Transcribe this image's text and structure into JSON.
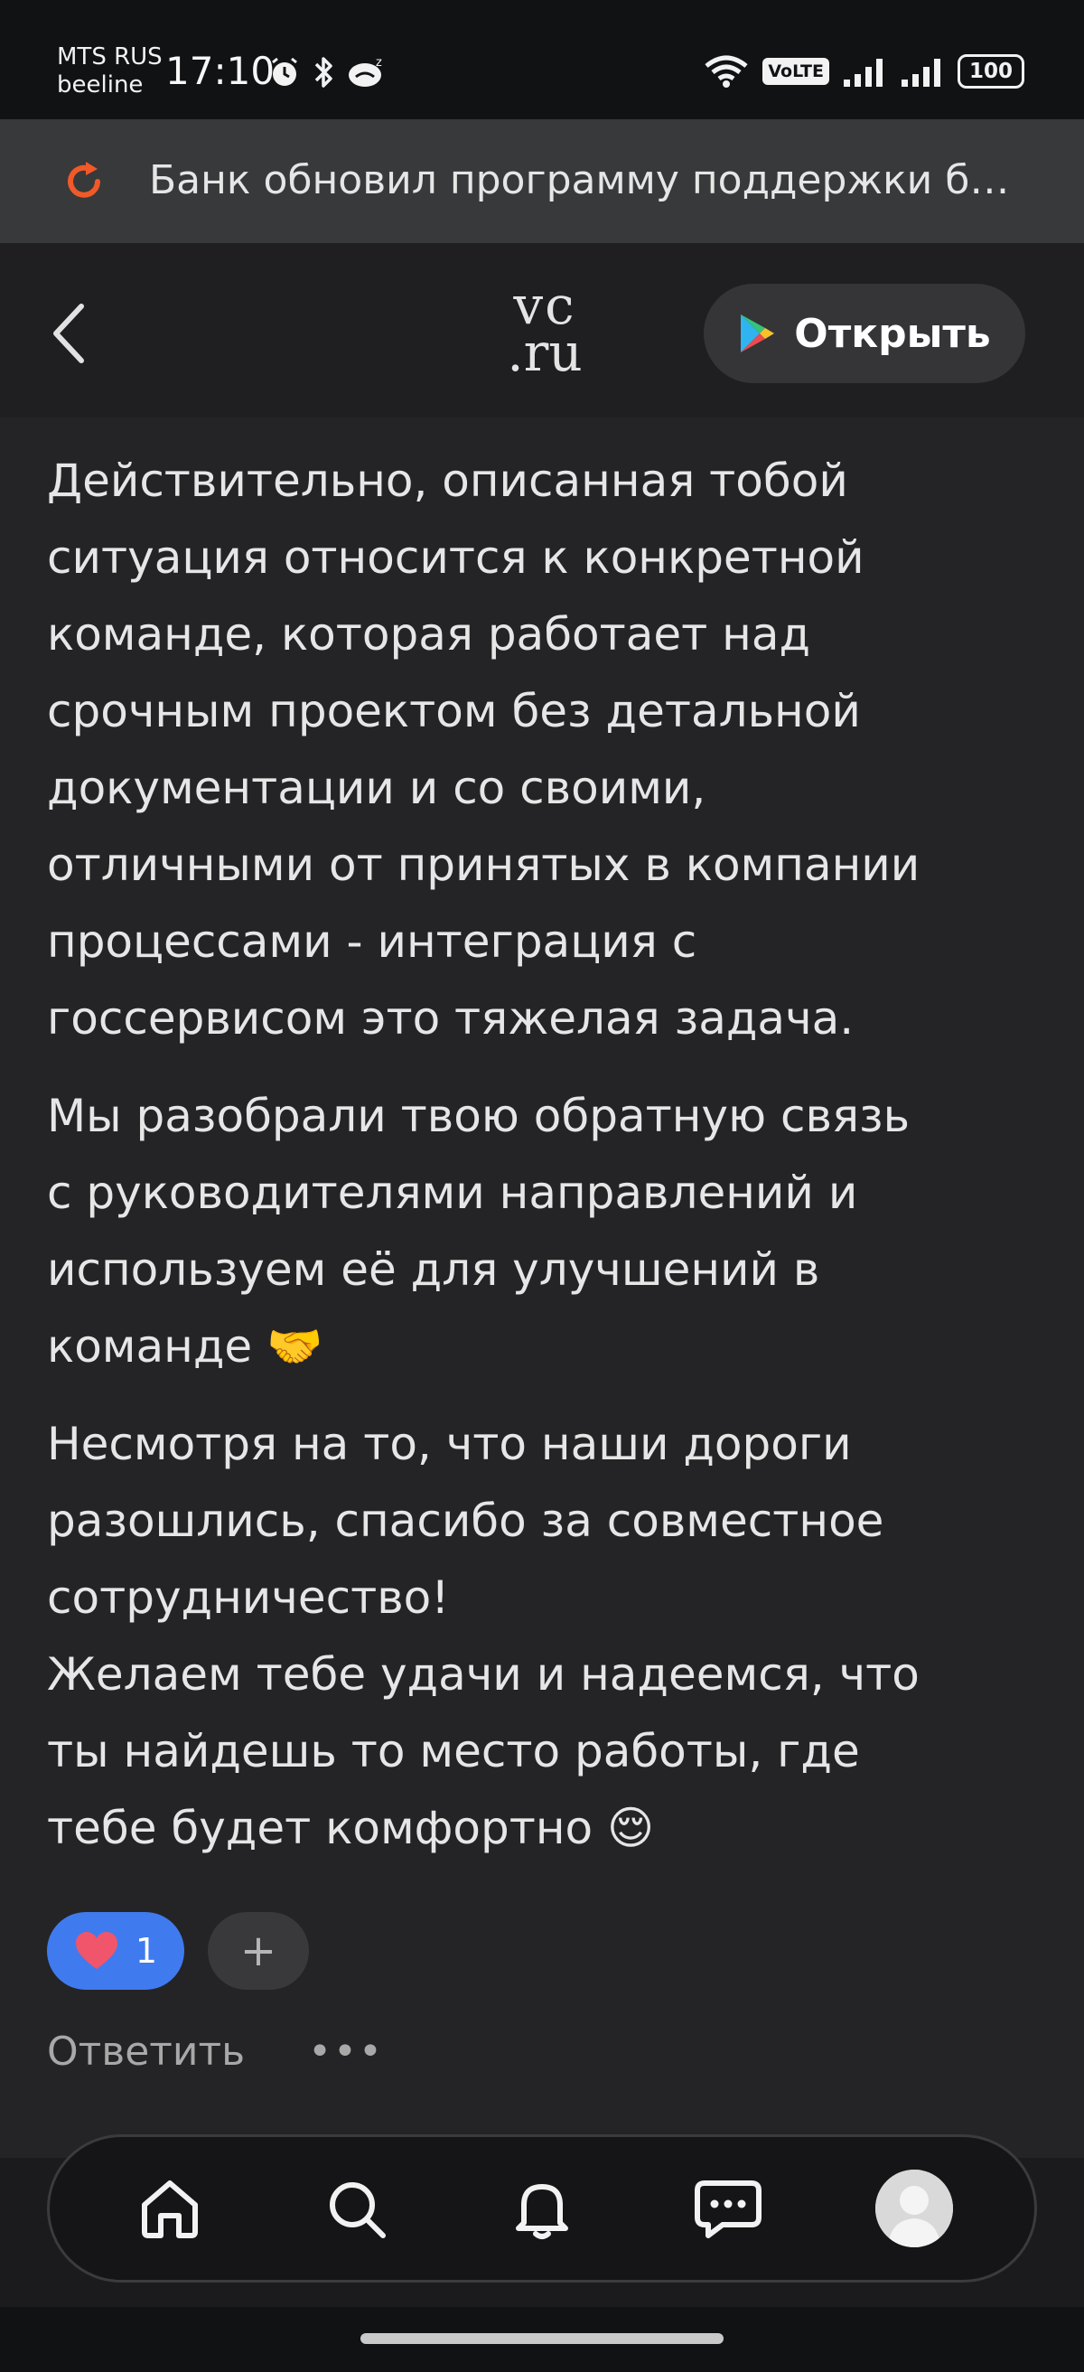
{
  "status_bar": {
    "carrier_1": "MTS RUS",
    "carrier_2": "beeline",
    "time": "17:10",
    "volte": "VoLTE",
    "battery": "100"
  },
  "notification": {
    "text": "Банк обновил программу поддержки би..."
  },
  "header": {
    "logo_line1": "vc",
    "logo_line2": ".ru",
    "open_label": "Открыть"
  },
  "comment": {
    "paragraphs": [
      "Действительно, описанная тобой\nситуация относится к конкретной\nкоманде, которая работает над\nсрочным проектом без детальной\nдокументации и со своими,\nотличными от принятых в компании\nпроцессами - интеграция с\nгоссервисом это тяжелая задача.",
      "Мы разобрали твою обратную связь\nс руководителями направлений и\nиспользуем её для улучшений в\nкоманде 🤝",
      "Несмотря на то, что наши дороги\nразошлись, спасибо за совместное\nсотрудничество!\nЖелаем тебе удачи и надеемся, что\nты найдешь то место работы, где\nтебе будет комфортно 😌"
    ],
    "like_count": "1",
    "add_reaction": "+",
    "reply_label": "Ответить",
    "more_label": "•••"
  },
  "nav": {
    "items": [
      "home-icon",
      "search-icon",
      "bell-icon",
      "chat-icon",
      "avatar"
    ]
  },
  "colors": {
    "accent_blue": "#3f7bef",
    "background": "#242426",
    "notif_icon": "#f05a28"
  }
}
